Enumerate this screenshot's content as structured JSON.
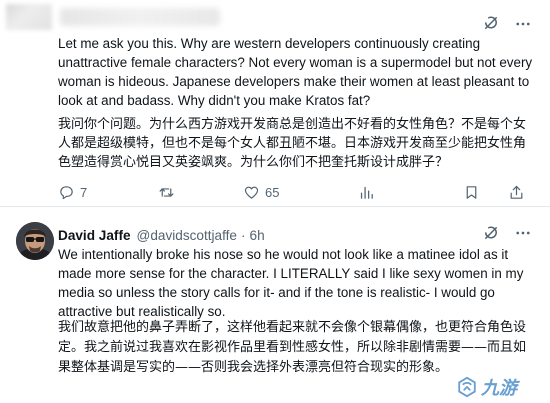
{
  "top_tweet": {
    "text_en": "Let me ask you this. Why are western developers continuously creating unattractive female characters? Not every woman is a supermodel but not every woman is hideous. Japanese developers make their women at least pleasant to look at and badass. Why didn't you make Kratos fat?",
    "text_zh": "我问你个问题。为什么西方游戏开发商总是创造出不好看的女性角色？不是每个女人都是超级模特，但也不是每个女人都丑陋不堪。日本游戏开发商至少能把女性角色塑造得赏心悦目又英姿飒爽。为什么你们不把奎托斯设计成胖子？",
    "actions": {
      "replies": "7",
      "reposts": "",
      "likes": "65",
      "views": ""
    }
  },
  "reply_tweet": {
    "author_name": "David Jaffe",
    "author_handle": "@davidscottjaffe",
    "separator": "·",
    "time": "6h",
    "text_en": "We intentionally broke his nose so he would not look like a matinee idol as it made more sense for the character. I LITERALLY said I like sexy women in my media so unless the story calls for it- and if the tone is realistic- I would go attractive but realistically so.",
    "text_zh": "我们故意把他的鼻子弄断了，这样他看起来就不会像个银幕偶像，也更符合角色设定。我之前说过我喜欢在影视作品里看到性感女性，所以除非剧情需要——而且如果整体基调是写实的——否则我会选择外表漂亮但符合现实的形象。"
  },
  "watermark": {
    "text": "九游"
  },
  "colors": {
    "text": "#0f1419",
    "muted": "#536471",
    "divider": "#e4e8eb",
    "watermark": "#4f8fc9"
  },
  "icons": [
    "grok-icon",
    "more-icon",
    "reply-icon",
    "repost-icon",
    "like-icon",
    "views-icon",
    "avatar",
    "nine-game-logo"
  ]
}
